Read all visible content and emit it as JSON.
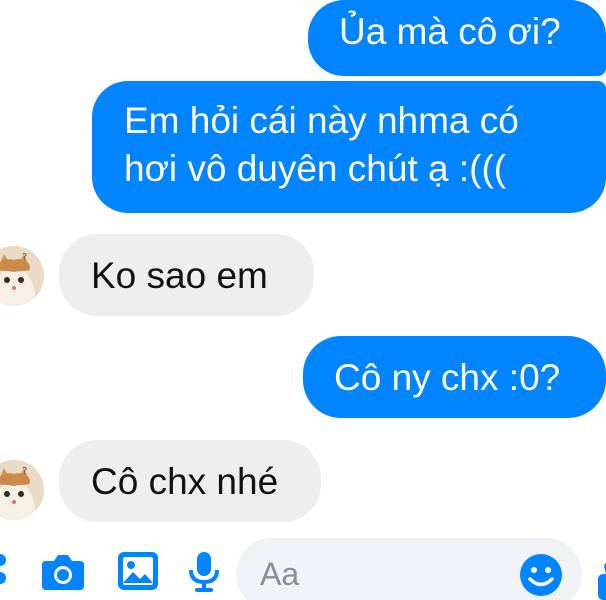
{
  "messages": [
    {
      "id": "m1",
      "direction": "sent",
      "lines": [
        "Ủa mà cô ơi?"
      ]
    },
    {
      "id": "m2",
      "direction": "sent",
      "lines": [
        "Em hỏi cái này nhma có",
        "hơi vô duyên chút ạ :((("
      ]
    },
    {
      "id": "m3",
      "direction": "received",
      "lines": [
        "Ko sao em"
      ]
    },
    {
      "id": "m4",
      "direction": "sent",
      "lines": [
        "Cô ny chx :0?"
      ]
    },
    {
      "id": "m5",
      "direction": "received",
      "lines": [
        "Cô chx nhé"
      ]
    }
  ],
  "composer": {
    "placeholder": "Aa"
  },
  "icons": {
    "more": "more-dots-icon",
    "camera": "camera-icon",
    "gallery": "image-icon",
    "mic": "microphone-icon",
    "emoji": "emoji-icon",
    "like": "like-icon",
    "avatar": "cat-avatar"
  },
  "colors": {
    "accent": "#0084ff",
    "received_bubble": "#eeeeee",
    "composer_bg": "#f0f2f5"
  }
}
